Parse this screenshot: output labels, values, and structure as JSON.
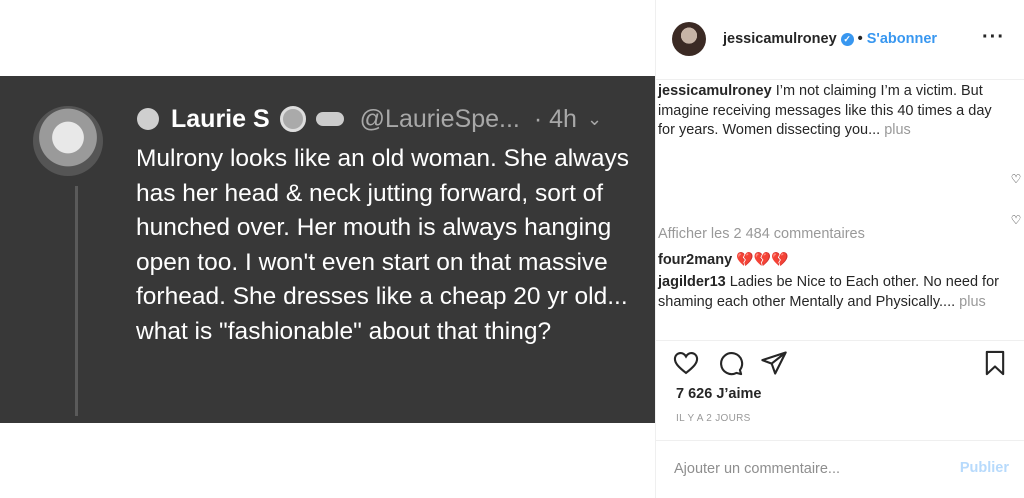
{
  "tweet": {
    "name": "Laurie S",
    "handle": "@LaurieSpe...",
    "time": "· 4h",
    "text": "Mulrony looks like an old woman. She always has her head & neck jutting forward, sort of hunched over. Her mouth is always hanging open too. I won't even start on that massive forhead. She dresses like a cheap 20 yr old... what is \"fashionable\" about that thing?"
  },
  "post": {
    "username": "jessicamulroney",
    "follow_label": "S'abonner",
    "more_icon": "···",
    "caption_user": "jessicamulroney",
    "caption": "I’m not claiming I’m a victim. But imagine receiving messages like this 40 times a day for years. Women dissecting you...",
    "caption_more": "plus",
    "view_all": "Afficher les 2 484 commentaires",
    "comments": [
      {
        "user": "four2many",
        "text": "💔💔💔"
      },
      {
        "user": "jagilder13",
        "text": "Ladies be Nice to Each other. No need for shaming each other Mentally and Physically....",
        "more": "plus"
      }
    ],
    "likes": "7 626 J’aime",
    "ago": "IL Y A 2 JOURS",
    "add_comment_placeholder": "Ajouter un commentaire...",
    "publish_label": "Publier"
  },
  "colors": {
    "accent": "#3897f0",
    "publish_disabled": "#b7dafc",
    "tweet_bg": "#383838"
  }
}
